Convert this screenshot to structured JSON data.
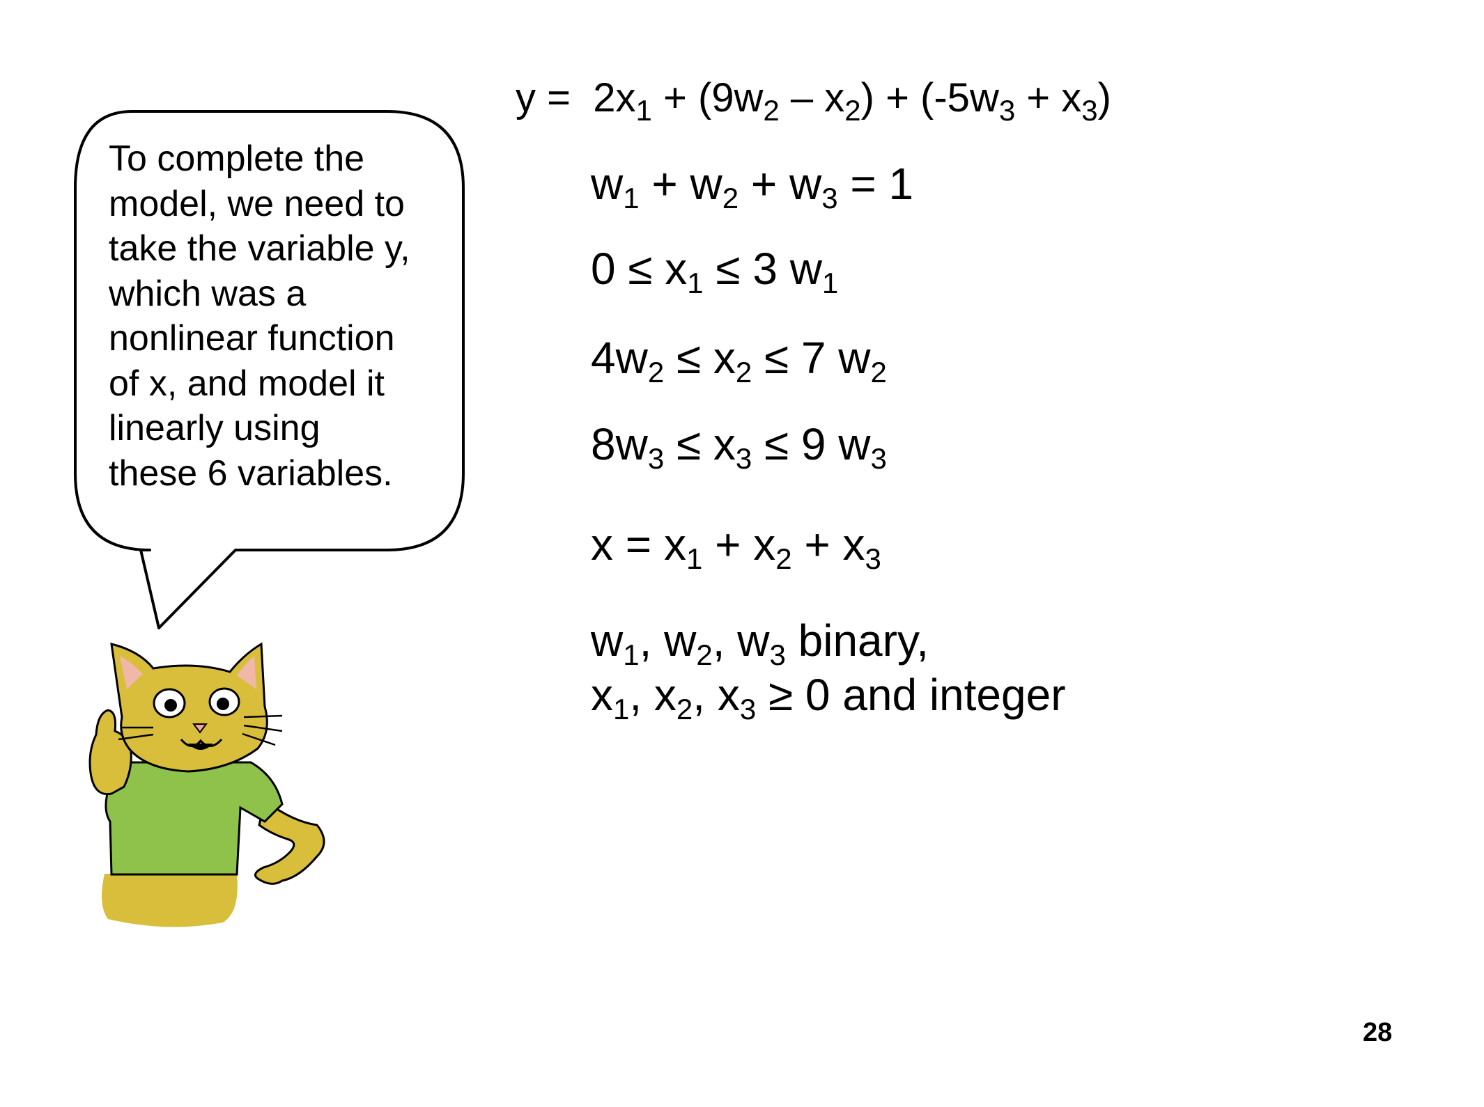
{
  "bubble": {
    "lines": [
      "To complete the",
      "model, we need to",
      "take the variable y,",
      "which was a",
      "nonlinear function",
      "of x, and model it",
      "linearly using",
      "these 6 variables."
    ]
  },
  "equations": {
    "objective": {
      "lhs": "y =",
      "p1": "2x",
      "s1": "1",
      "p2": " + (9w",
      "s2": "2",
      "p3": " – x",
      "s3": "2",
      "p4": ") + (-5w",
      "s4": "3",
      "p5": " + x",
      "s5": "3",
      "p6": ")"
    },
    "sum_w": {
      "p1": "w",
      "s1": "1",
      "p2": " + w",
      "s2": "2",
      "p3": " + w",
      "s3": "3",
      "p4": " = 1"
    },
    "bound1": {
      "p1": "0 ≤ x",
      "s1": "1",
      "p2": " ≤ 3 w",
      "s2": "1"
    },
    "bound2": {
      "p1": "4w",
      "s1": "2",
      "p2": " ≤ x",
      "s2": "2",
      "p3": " ≤ 7 w",
      "s3": "2"
    },
    "bound3": {
      "p1": "8w",
      "s1": "3",
      "p2": " ≤ x",
      "s2": "3",
      "p3": " ≤ 9 w",
      "s3": "3"
    },
    "sum_x": {
      "p1": "x = x",
      "s1": "1",
      "p2": " + x",
      "s2": "2",
      "p3": " + x",
      "s3": "3"
    },
    "binary": {
      "p1": "w",
      "s1": "1",
      "p2": ", w",
      "s2": "2",
      "p3": ", w",
      "s3": "3",
      "p4": " binary,"
    },
    "integer": {
      "p1": "x",
      "s1": "1",
      "p2": ", x",
      "s2": "2",
      "p3": ", x",
      "s3": "3",
      "p4": " ≥ 0 and integer"
    }
  },
  "page_number": "28",
  "colors": {
    "cat_fur": "#d9be3c",
    "cat_shirt": "#8ec24a",
    "cat_ear_inner": "#f1b7a8"
  },
  "icons": {
    "speech_bubble": "speech-bubble",
    "mascot": "cat-character"
  }
}
